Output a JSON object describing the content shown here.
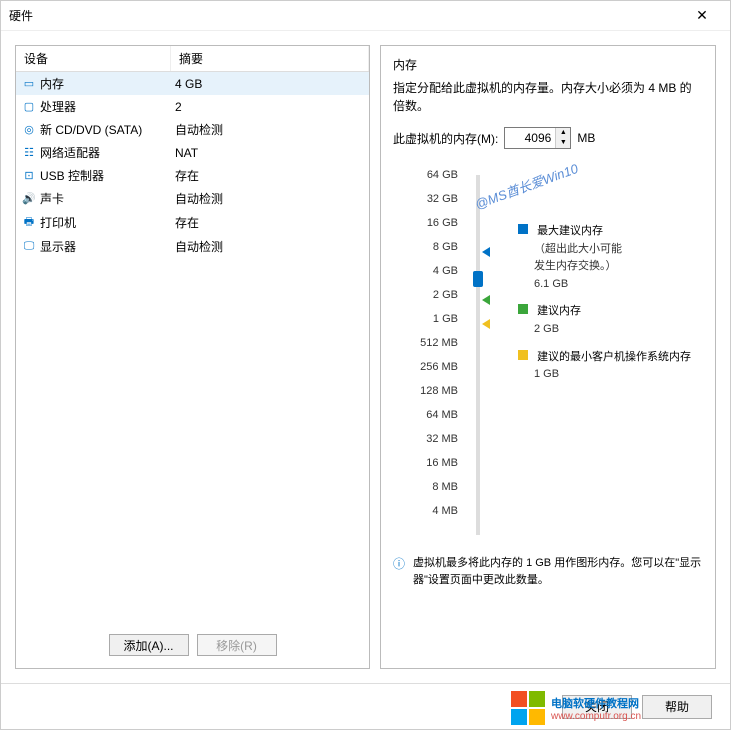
{
  "window": {
    "title": "硬件"
  },
  "devices": {
    "header_device": "设备",
    "header_summary": "摘要",
    "rows": [
      {
        "icon": "▭",
        "name": "内存",
        "summary": "4 GB",
        "selected": true
      },
      {
        "icon": "▢",
        "name": "处理器",
        "summary": "2"
      },
      {
        "icon": "◎",
        "name": "新 CD/DVD (SATA)",
        "summary": "自动检测"
      },
      {
        "icon": "☷",
        "name": "网络适配器",
        "summary": "NAT"
      },
      {
        "icon": "⊡",
        "name": "USB 控制器",
        "summary": "存在"
      },
      {
        "icon": "🔊",
        "name": "声卡",
        "summary": "自动检测"
      },
      {
        "icon": "🖶",
        "name": "打印机",
        "summary": "存在"
      },
      {
        "icon": "🖵",
        "name": "显示器",
        "summary": "自动检测"
      }
    ]
  },
  "buttons": {
    "add": "添加(A)...",
    "remove": "移除(R)",
    "close": "关闭",
    "help": "帮助"
  },
  "memory": {
    "title": "内存",
    "desc": "指定分配给此虚拟机的内存量。内存大小必须为 4 MB 的倍数。",
    "label": "此虚拟机的内存(M):",
    "value": "4096",
    "unit": "MB",
    "ticks": [
      "64 GB",
      "32 GB",
      "16 GB",
      "8 GB",
      "4 GB",
      "2 GB",
      "1 GB",
      "512 MB",
      "256 MB",
      "128 MB",
      "64 MB",
      "32 MB",
      "16 MB",
      "8 MB",
      "4 MB"
    ],
    "legend_max_title": "最大建议内存",
    "legend_max_sub1": "（超出此大小可能",
    "legend_max_sub2": "发生内存交换。）",
    "legend_max_val": "6.1 GB",
    "legend_rec_title": "建议内存",
    "legend_rec_val": "2 GB",
    "legend_min_title": "建议的最小客户机操作系统内存",
    "legend_min_val": "1 GB",
    "note": "虚拟机最多将此内存的 1 GB 用作图形内存。您可以在\"显示器\"设置页面中更改此数量。"
  },
  "watermark": "@MS酋长爱Win10",
  "branding": {
    "line1": "电脑软硬件教程网",
    "line2": "www.computr.org.cn"
  }
}
